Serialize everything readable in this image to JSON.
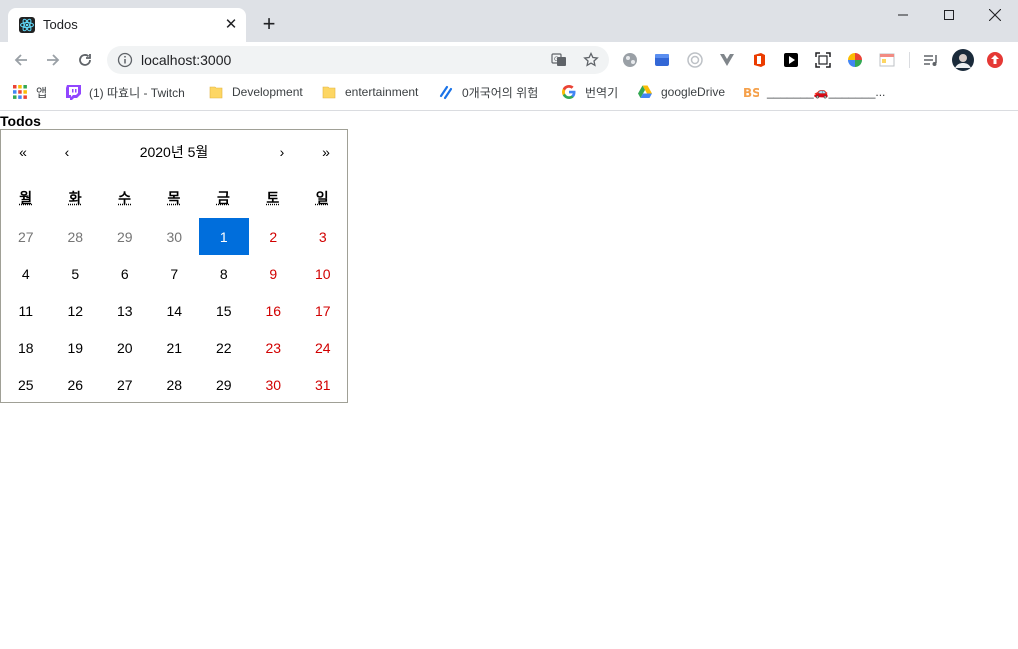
{
  "browser": {
    "tab_title": "Todos",
    "tab_close": "✕",
    "new_tab": "+",
    "url": "localhost:3000",
    "bookmarks": [
      {
        "label": "앱",
        "icon": "apps-grid-icon"
      },
      {
        "label": "(1) 따효니 - Twitch",
        "icon": "twitch-icon"
      },
      {
        "label": "Development",
        "icon": "folder-icon"
      },
      {
        "label": "entertainment",
        "icon": "folder-icon"
      },
      {
        "label": "0개국어의 위험",
        "icon": "link-icon"
      },
      {
        "label": "번역기",
        "icon": "google-icon"
      },
      {
        "label": "googleDrive",
        "icon": "drive-icon"
      },
      {
        "label": "_______🚗_______...",
        "icon": "bs-icon"
      }
    ]
  },
  "page": {
    "title": "Todos"
  },
  "calendar": {
    "nav": {
      "prev_year": "«",
      "prev_month": "‹",
      "label": "2020년 5월",
      "next_month": "›",
      "next_year": "»"
    },
    "weekdays": [
      "월",
      "화",
      "수",
      "목",
      "금",
      "토",
      "일"
    ],
    "days": [
      {
        "d": "27",
        "type": "neighbor"
      },
      {
        "d": "28",
        "type": "neighbor"
      },
      {
        "d": "29",
        "type": "neighbor"
      },
      {
        "d": "30",
        "type": "neighbor"
      },
      {
        "d": "1",
        "type": "active"
      },
      {
        "d": "2",
        "type": "weekend"
      },
      {
        "d": "3",
        "type": "weekend"
      },
      {
        "d": "4",
        "type": ""
      },
      {
        "d": "5",
        "type": ""
      },
      {
        "d": "6",
        "type": ""
      },
      {
        "d": "7",
        "type": ""
      },
      {
        "d": "8",
        "type": ""
      },
      {
        "d": "9",
        "type": "weekend"
      },
      {
        "d": "10",
        "type": "weekend"
      },
      {
        "d": "11",
        "type": ""
      },
      {
        "d": "12",
        "type": ""
      },
      {
        "d": "13",
        "type": ""
      },
      {
        "d": "14",
        "type": ""
      },
      {
        "d": "15",
        "type": ""
      },
      {
        "d": "16",
        "type": "weekend"
      },
      {
        "d": "17",
        "type": "weekend"
      },
      {
        "d": "18",
        "type": ""
      },
      {
        "d": "19",
        "type": ""
      },
      {
        "d": "20",
        "type": ""
      },
      {
        "d": "21",
        "type": ""
      },
      {
        "d": "22",
        "type": ""
      },
      {
        "d": "23",
        "type": "weekend"
      },
      {
        "d": "24",
        "type": "weekend"
      },
      {
        "d": "25",
        "type": ""
      },
      {
        "d": "26",
        "type": ""
      },
      {
        "d": "27",
        "type": ""
      },
      {
        "d": "28",
        "type": ""
      },
      {
        "d": "29",
        "type": ""
      },
      {
        "d": "30",
        "type": "weekend"
      },
      {
        "d": "31",
        "type": "weekend"
      }
    ],
    "colors": {
      "active_bg": "#006edc",
      "weekend": "#d10000",
      "neighbor": "#757575"
    }
  }
}
